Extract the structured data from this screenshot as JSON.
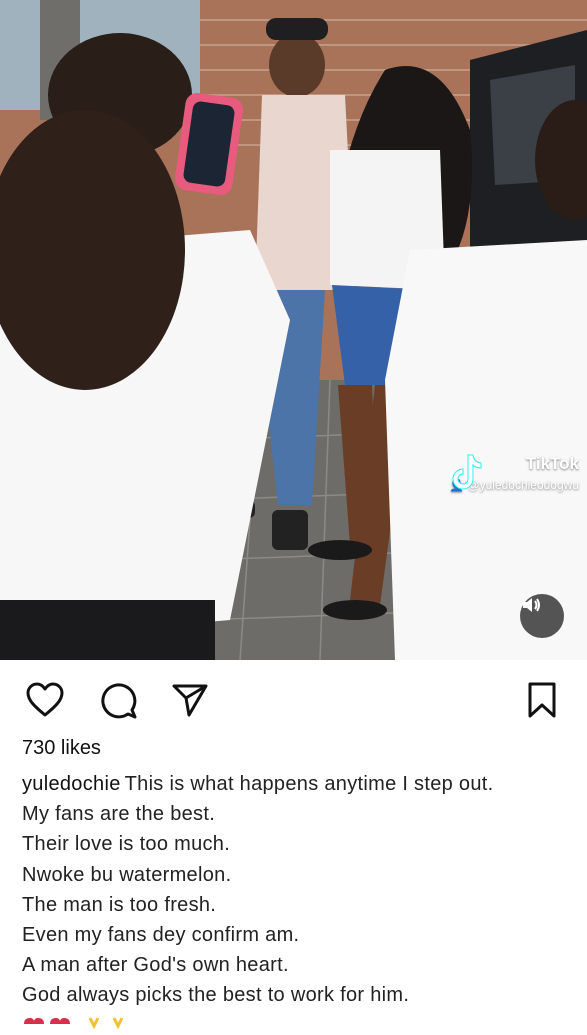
{
  "post": {
    "likes": "730 likes",
    "username": "yuledochie",
    "caption_first": "This is what happens anytime I step out.",
    "caption_lines": [
      "My fans are the best.",
      "Their love is too much.",
      "Nwoke bu watermelon.",
      "The man is too fresh.",
      "Even my fans dey confirm am.",
      "A man after God's own heart.",
      "God always picks the best to work for him."
    ]
  },
  "video_overlay": {
    "watermark_name": "TikTok",
    "watermark_handle": "@yuledochieodogwu"
  },
  "icons": {
    "like": "heart-icon",
    "comment": "comment-icon",
    "share": "send-icon",
    "save": "bookmark-icon",
    "mute": "speaker-icon"
  },
  "colors": {
    "text": "#222222",
    "background": "#ffffff",
    "emoji_red": "#d8304a",
    "emoji_yellow": "#f2c232"
  }
}
